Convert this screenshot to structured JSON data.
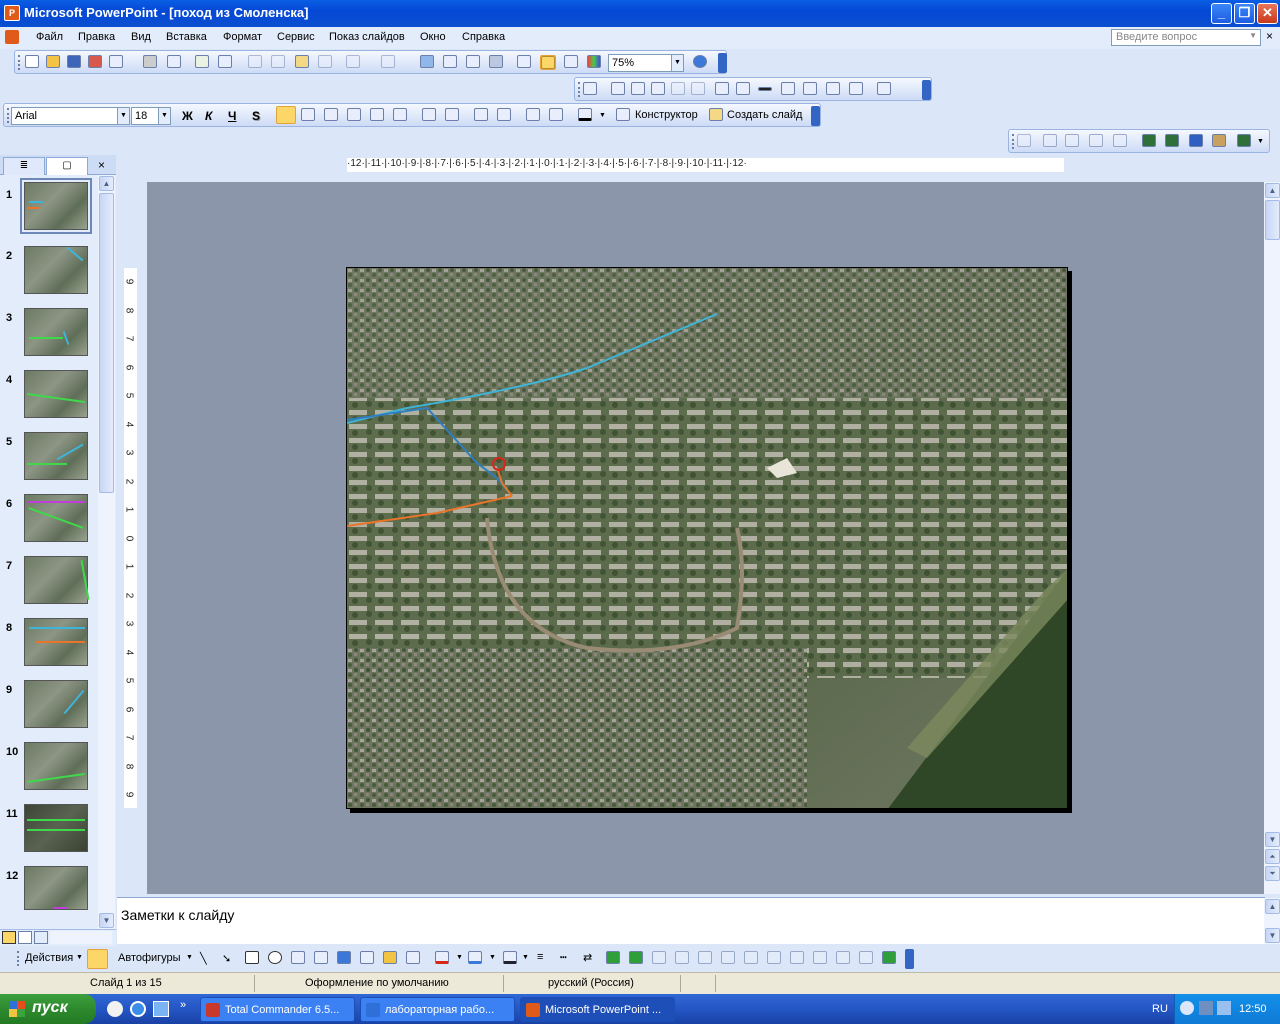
{
  "window": {
    "title": "Microsoft PowerPoint - [поход из Смоленска]",
    "app_icon": "powerpoint-icon"
  },
  "menu": {
    "items": [
      "Файл",
      "Правка",
      "Вид",
      "Вставка",
      "Формат",
      "Сервис",
      "Показ слайдов",
      "Окно",
      "Справка"
    ],
    "help_box_placeholder": "Введите вопрос"
  },
  "standard_toolbar": {
    "zoom": "75%"
  },
  "formatting_toolbar": {
    "font": "Arial",
    "size": "18",
    "bold": "Ж",
    "italic": "К",
    "underline": "Ч",
    "shadow": "S",
    "designer_label": "Конструктор",
    "new_slide_label": "Создать слайд"
  },
  "ruler": {
    "horizontal": "·12·|·11·|·10·|·9·|·8·|·7·|·6·|·5·|·4·|·3·|·2·|·1·|·0·|·1·|·2·|·3·|·4·|·5·|·6·|·7·|·8·|·9·|·10·|·11·|·12·",
    "vertical": [
      "9",
      "8",
      "7",
      "6",
      "5",
      "4",
      "3",
      "2",
      "1",
      "0",
      "1",
      "2",
      "3",
      "4",
      "5",
      "6",
      "7",
      "8",
      "9"
    ]
  },
  "slides_panel": {
    "numbers": [
      "1",
      "2",
      "3",
      "4",
      "5",
      "6",
      "7",
      "8",
      "9",
      "10",
      "11",
      "12"
    ],
    "selected": 1
  },
  "notes": {
    "placeholder": "Заметки к слайду"
  },
  "drawing_toolbar": {
    "actions_label": "Действия",
    "autoshapes_label": "Автофигуры"
  },
  "status_bar": {
    "slide_info": "Слайд 1 из 15",
    "design": "Оформление по умолчанию",
    "language": "русский (Россия)"
  },
  "taskbar": {
    "start_label": "пуск",
    "tasks": [
      {
        "label": "Total Commander 6.5...",
        "active": false
      },
      {
        "label": "лабораторная рабо...",
        "active": false
      },
      {
        "label": "Microsoft PowerPoint ...",
        "active": true
      }
    ],
    "lang": "RU",
    "time": "12:50"
  },
  "colors": {
    "route_blue": "#3fb4d8",
    "route_dark_blue": "#2f7fc0",
    "route_orange": "#e8752a",
    "marker_red": "#d9261b",
    "workspace": "#8c96aa"
  }
}
